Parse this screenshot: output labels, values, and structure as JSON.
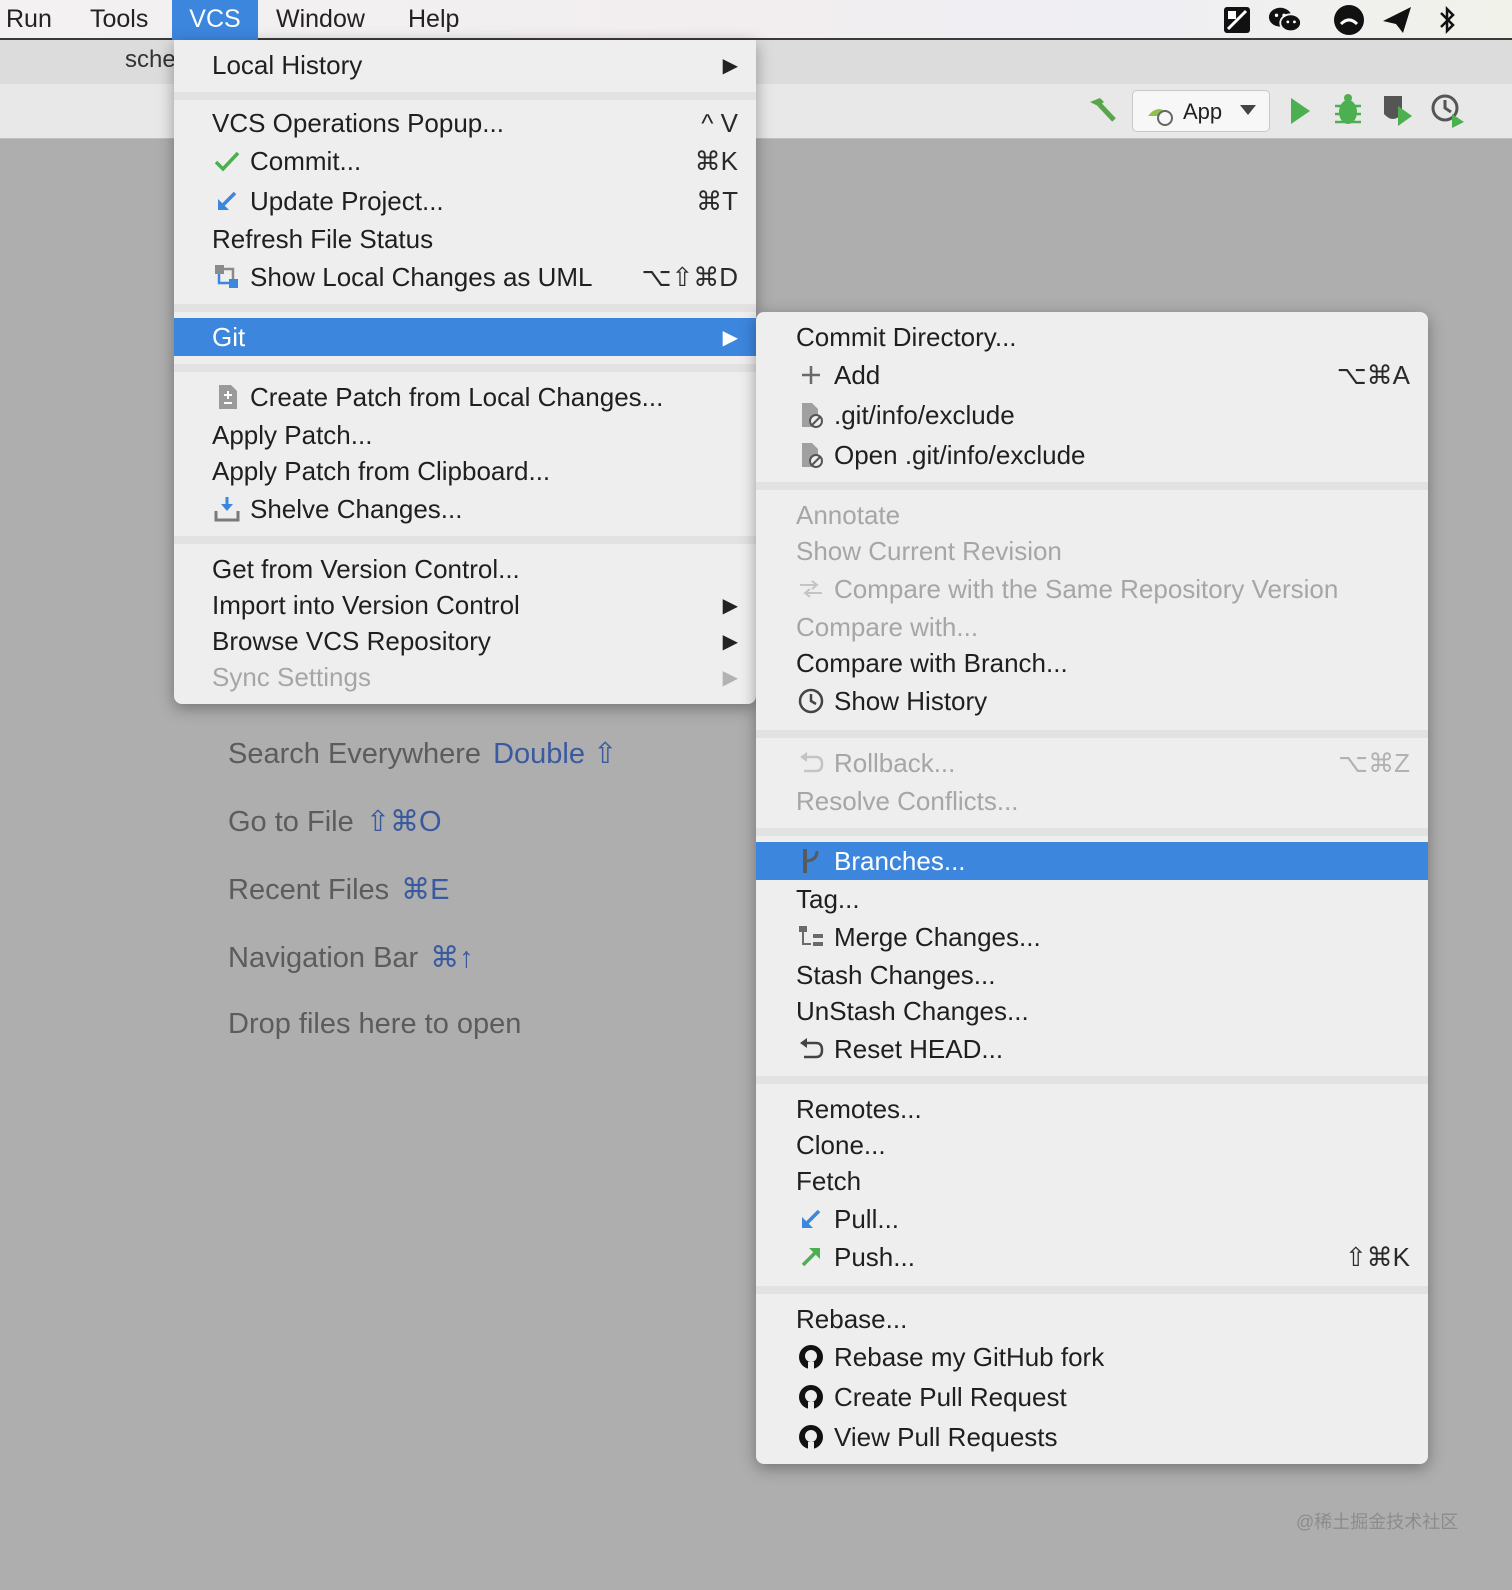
{
  "menubar": {
    "run": "Run",
    "tools": "Tools",
    "vcs": "VCS",
    "window": "Window",
    "help": "Help"
  },
  "tabstrip": {
    "tab_partial": "sche"
  },
  "toolbar": {
    "config_label": "App"
  },
  "vcs_menu": {
    "local_history": "Local History",
    "vcs_ops": "VCS Operations Popup...",
    "vcs_ops_sc": "^ V",
    "commit": "Commit...",
    "commit_sc": "⌘K",
    "update": "Update Project...",
    "update_sc": "⌘T",
    "refresh": "Refresh File Status",
    "show_uml": "Show Local Changes as UML",
    "show_uml_sc": "⌥⇧⌘D",
    "git": "Git",
    "create_patch": "Create Patch from Local Changes...",
    "apply_patch": "Apply Patch...",
    "apply_clip": "Apply Patch from Clipboard...",
    "shelve": "Shelve Changes...",
    "get_vc": "Get from Version Control...",
    "import_vc": "Import into Version Control",
    "browse_vcs": "Browse VCS Repository",
    "sync": "Sync Settings"
  },
  "git_menu": {
    "commit_dir": "Commit Directory...",
    "add": "Add",
    "add_sc": "⌥⌘A",
    "exclude": ".git/info/exclude",
    "open_exclude": "Open .git/info/exclude",
    "annotate": "Annotate",
    "show_rev": "Show Current Revision",
    "compare_same": "Compare with the Same Repository Version",
    "compare_with": "Compare with...",
    "compare_branch": "Compare with Branch...",
    "show_history": "Show History",
    "rollback": "Rollback...",
    "rollback_sc": "⌥⌘Z",
    "resolve": "Resolve Conflicts...",
    "branches": "Branches...",
    "tag": "Tag...",
    "merge": "Merge Changes...",
    "stash": "Stash Changes...",
    "unstash": "UnStash Changes...",
    "reset": "Reset HEAD...",
    "remotes": "Remotes...",
    "clone": "Clone...",
    "fetch": "Fetch",
    "pull": "Pull...",
    "push": "Push...",
    "push_sc": "⇧⌘K",
    "rebase": "Rebase...",
    "rebase_fork": "Rebase my GitHub fork",
    "create_pr": "Create Pull Request",
    "view_pr": "View Pull Requests"
  },
  "welcome": {
    "search": "Search Everywhere",
    "search_sc": "Double ⇧",
    "goto": "Go to File",
    "goto_sc": "⇧⌘O",
    "recent": "Recent Files",
    "recent_sc": "⌘E",
    "navbar": "Navigation Bar",
    "navbar_sc": "⌘↑",
    "drop": "Drop files here to open"
  },
  "watermark": "@稀土掘金技术社区",
  "colors": {
    "selection": "#3d86de",
    "menu_bg": "#efeeef",
    "shortcut_blue": "#3a5a9f",
    "green": "#4caf50"
  }
}
